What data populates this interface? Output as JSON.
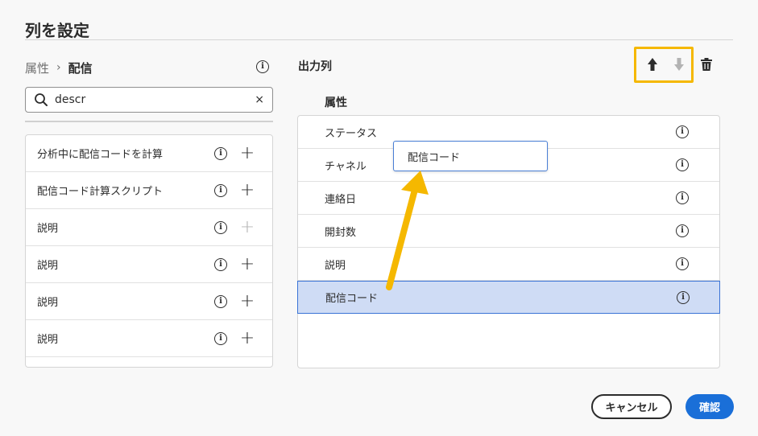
{
  "dialog": {
    "title": "列を設定"
  },
  "left": {
    "breadcrumb": {
      "parent": "属性",
      "separator": "›",
      "current": "配信"
    },
    "search": {
      "value": "descr",
      "placeholder": ""
    },
    "items": [
      {
        "label": "分析中に配信コードを計算",
        "add_enabled": true
      },
      {
        "label": "配信コード計算スクリプト",
        "add_enabled": true
      },
      {
        "label": "説明",
        "add_enabled": false
      },
      {
        "label": "説明",
        "add_enabled": true
      },
      {
        "label": "説明",
        "add_enabled": true
      },
      {
        "label": "説明",
        "add_enabled": true
      }
    ]
  },
  "right": {
    "title": "出力列",
    "column_header": "属性",
    "rows": [
      {
        "label": "ステータス",
        "selected": false
      },
      {
        "label": "チャネル",
        "selected": false
      },
      {
        "label": "連絡日",
        "selected": false
      },
      {
        "label": "開封数",
        "selected": false
      },
      {
        "label": "説明",
        "selected": false
      },
      {
        "label": "配信コード",
        "selected": true
      }
    ],
    "drag_tooltip": "配信コード"
  },
  "icons": {
    "info": "i",
    "add": "+",
    "clear": "×"
  },
  "footer": {
    "cancel_label": "キャンセル",
    "confirm_label": "確認"
  },
  "colors": {
    "accent": "#1a6fd8",
    "highlight": "#f5b800",
    "selected_bg": "#cfdcf5",
    "selected_border": "#3a73d6"
  }
}
